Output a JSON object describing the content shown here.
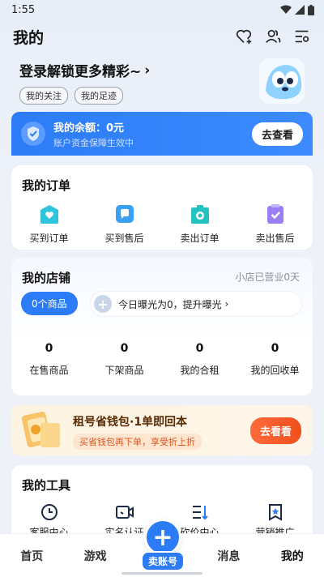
{
  "status_bar": {
    "time": "1:55"
  },
  "header": {
    "title": "我的"
  },
  "login": {
    "title": "登录解锁更多精彩~",
    "arrow": "›",
    "tags": [
      "我的关注",
      "我的足迹"
    ]
  },
  "balance": {
    "label": "我的余额：0元",
    "sub": "账户资金保障生效中",
    "button": "去查看"
  },
  "orders": {
    "title": "我的订单",
    "items": [
      {
        "label": "买到订单",
        "icon": "heart-bag-icon",
        "color": "#2ec4dc"
      },
      {
        "label": "买到售后",
        "icon": "chat-icon",
        "color": "#3aa0f5"
      },
      {
        "label": "卖出订单",
        "icon": "camera-bag-icon",
        "color": "#25c2c0"
      },
      {
        "label": "卖出售后",
        "icon": "clipboard-check-icon",
        "color": "#9a7ef5"
      }
    ]
  },
  "shop": {
    "title": "我的店铺",
    "status": "小店已营业0天",
    "goods_button": "0个商品",
    "exposure_text": "今日曝光为0，提升曝光",
    "stats": [
      {
        "value": "0",
        "label": "在售商品"
      },
      {
        "value": "0",
        "label": "下架商品"
      },
      {
        "value": "0",
        "label": "我的合租"
      },
      {
        "value": "0",
        "label": "我的回收单"
      }
    ]
  },
  "promo": {
    "title": "租号省钱包·1单即回本",
    "sub": "买省钱包再下单，享受折上折",
    "button": "去看看"
  },
  "tools": {
    "title": "我的工具",
    "items": [
      {
        "label": "客服中心",
        "icon": "clock-icon"
      },
      {
        "label": "实名认证",
        "icon": "video-icon"
      },
      {
        "label": "砍价中心",
        "icon": "sort-icon"
      },
      {
        "label": "营销推广",
        "icon": "star-bookmark-icon"
      }
    ]
  },
  "tabbar": {
    "items": [
      "首页",
      "游戏",
      "消息",
      "我的"
    ],
    "sell": "卖账号",
    "sell_icon": "+"
  }
}
